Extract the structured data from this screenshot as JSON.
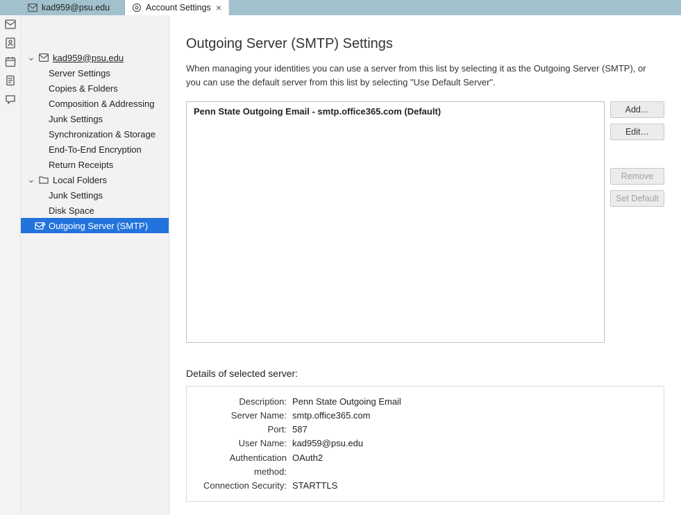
{
  "tabs": {
    "mail": {
      "label": "kad959@psu.edu"
    },
    "settings": {
      "label": "Account Settings"
    }
  },
  "sidebar": {
    "account": {
      "label": "kad959@psu.edu",
      "items": [
        {
          "label": "Server Settings"
        },
        {
          "label": "Copies & Folders"
        },
        {
          "label": "Composition & Addressing"
        },
        {
          "label": "Junk Settings"
        },
        {
          "label": "Synchronization & Storage"
        },
        {
          "label": "End-To-End Encryption"
        },
        {
          "label": "Return Receipts"
        }
      ]
    },
    "local": {
      "label": "Local Folders",
      "items": [
        {
          "label": "Junk Settings"
        },
        {
          "label": "Disk Space"
        }
      ]
    },
    "smtp": {
      "label": "Outgoing Server (SMTP)"
    }
  },
  "content": {
    "heading": "Outgoing Server (SMTP) Settings",
    "description": "When managing your identities you can use a server from this list by selecting it as the Outgoing Server (SMTP), or you can use the default server from this list by selecting \"Use Default Server\".",
    "server_row": "Penn State Outgoing Email - smtp.office365.com (Default)",
    "buttons": {
      "add": "Add…",
      "edit": "Edit…",
      "remove": "Remove",
      "setdefault": "Set Default"
    },
    "details_heading": "Details of selected server:",
    "details": {
      "description_k": "Description:",
      "description_v": "Penn State Outgoing Email",
      "servername_k": "Server Name:",
      "servername_v": "smtp.office365.com",
      "port_k": "Port:",
      "port_v": "587",
      "username_k": "User Name:",
      "username_v": "kad959@psu.edu",
      "auth_k": "Authentication method:",
      "auth_v": "OAuth2",
      "sec_k": "Connection Security:",
      "sec_v": "STARTTLS"
    }
  }
}
